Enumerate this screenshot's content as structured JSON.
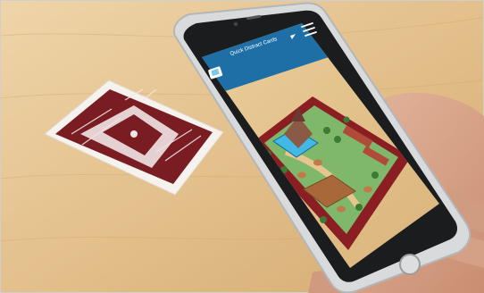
{
  "app": {
    "title": "Quick Distract Cards",
    "book_icon": "book-icon",
    "dropdown_icon": "caret-down-icon",
    "menu_icon": "hamburger-menu-icon"
  },
  "colors": {
    "table": "#e3c08c",
    "card_maroon": "#7a1d23",
    "app_bar": "#1d6fa6",
    "board_maroon": "#8a1e22",
    "grass": "#7fb86a",
    "phone_body": "#d8dadb",
    "hand": "#d8a88f"
  }
}
